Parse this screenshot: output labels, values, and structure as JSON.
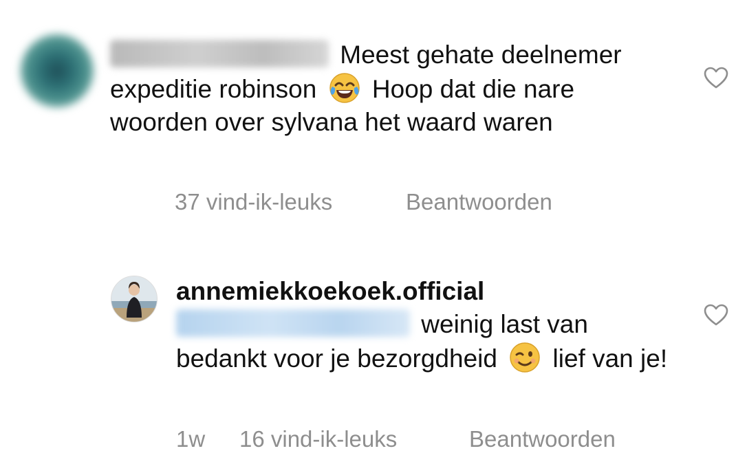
{
  "comments": [
    {
      "username_text": "",
      "text_line": "Meest gehate deelnemer expeditie robinson",
      "text_after_emoji": "Hoop dat die nare woorden over sylvana het waard waren",
      "emoji": "face-with-tears-of-joy",
      "likes": "37 vind-ik-leuks",
      "reply": "Beantwoorden"
    },
    {
      "username": "annemiekkoekoek.official",
      "text_before_emoji": "weinig last van bedankt voor je bezorgdheid",
      "emoji": "winking-face",
      "text_after_emoji": "lief van je!",
      "time": "1w",
      "likes": "16 vind-ik-leuks",
      "reply": "Beantwoorden"
    }
  ],
  "colors": {
    "text": "#111111",
    "meta": "#8e8e8e",
    "heart_stroke": "#8e8e8e"
  }
}
